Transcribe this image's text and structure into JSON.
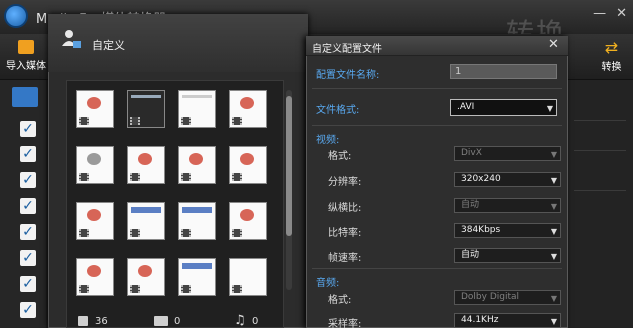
{
  "app": {
    "title": "Media F...     媒体转换器",
    "import_label": "导入媒体",
    "convert_label": "转换",
    "watermark_text": "转换"
  },
  "custom_dialog": {
    "title": "自定义",
    "stats": {
      "video_count": "36",
      "image_count": "0",
      "audio_count": "0"
    }
  },
  "profile_dialog": {
    "title": "自定义配置文件",
    "close_glyph": "✕",
    "name_label": "配置文件名称:",
    "name_value": "1",
    "format_label": "文件格式:",
    "format_value": ".AVI",
    "video_section": "视频:",
    "video": {
      "codec_label": "格式:",
      "codec_value": "DivX",
      "resolution_label": "分辨率:",
      "resolution_value": "320x240",
      "aspect_label": "纵横比:",
      "aspect_value": "自动",
      "bitrate_label": "比特率:",
      "bitrate_value": "384Kbps",
      "framerate_label": "帧速率:",
      "framerate_value": "自动"
    },
    "audio_section": "音频:",
    "audio": {
      "codec_label": "格式:",
      "codec_value": "Dolby Digital",
      "samplerate_label": "采样率:",
      "samplerate_value": "44.1KHz"
    }
  },
  "colors": {
    "accent": "#59a9f0",
    "check_bg": "#f2f2f2",
    "select_all": "#3478c6"
  }
}
